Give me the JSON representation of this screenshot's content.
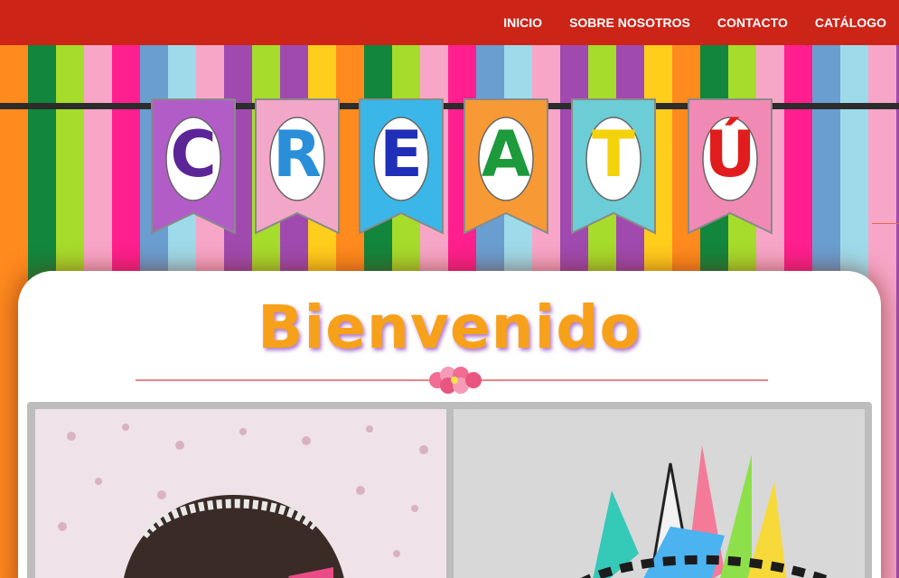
{
  "nav": {
    "items": [
      {
        "label": "INICIO"
      },
      {
        "label": "SOBRE NOSOTROS"
      },
      {
        "label": "CONTACTO"
      },
      {
        "label": "CATÁLOGO"
      }
    ]
  },
  "banner": {
    "letters": [
      "C",
      "R",
      "E",
      "A",
      "T",
      "Ú"
    ],
    "letter_colors": [
      "#5b2597",
      "#2a8fd8",
      "#1f2fb8",
      "#1c9a3c",
      "#f4d20c",
      "#e11c1c"
    ],
    "flag_colors": [
      "#b25cc8",
      "#f3a7c8",
      "#3ab7e8",
      "#f79a35",
      "#6ccdd6",
      "#f08ab5"
    ]
  },
  "stripe_colors": [
    "#ff8a1e",
    "#12863c",
    "#a6dc2c",
    "#f8a6c8",
    "#ff1f8e",
    "#6a9ed0",
    "#9edbea",
    "#f8a6c8",
    "#a04ab0",
    "#a6dc2c",
    "#a04ab0",
    "#ffcd1c",
    "#ff8a1e",
    "#12863c",
    "#a6dc2c",
    "#f8a6c8",
    "#ff1f8e",
    "#6a9ed0",
    "#9edbea",
    "#f8a6c8",
    "#a04ab0",
    "#a6dc2c",
    "#a04ab0",
    "#ffcd1c",
    "#ff8a1e",
    "#12863c",
    "#a6dc2c",
    "#f8a6c8",
    "#ff1f8e",
    "#6a9ed0",
    "#9edbea",
    "#f8a6c8",
    "#a04ab0"
  ],
  "main": {
    "title": "Bienvenido"
  },
  "colors": {
    "nav_bar": "#cc2417",
    "title": "#f7a11a",
    "divider": "#e88585"
  }
}
